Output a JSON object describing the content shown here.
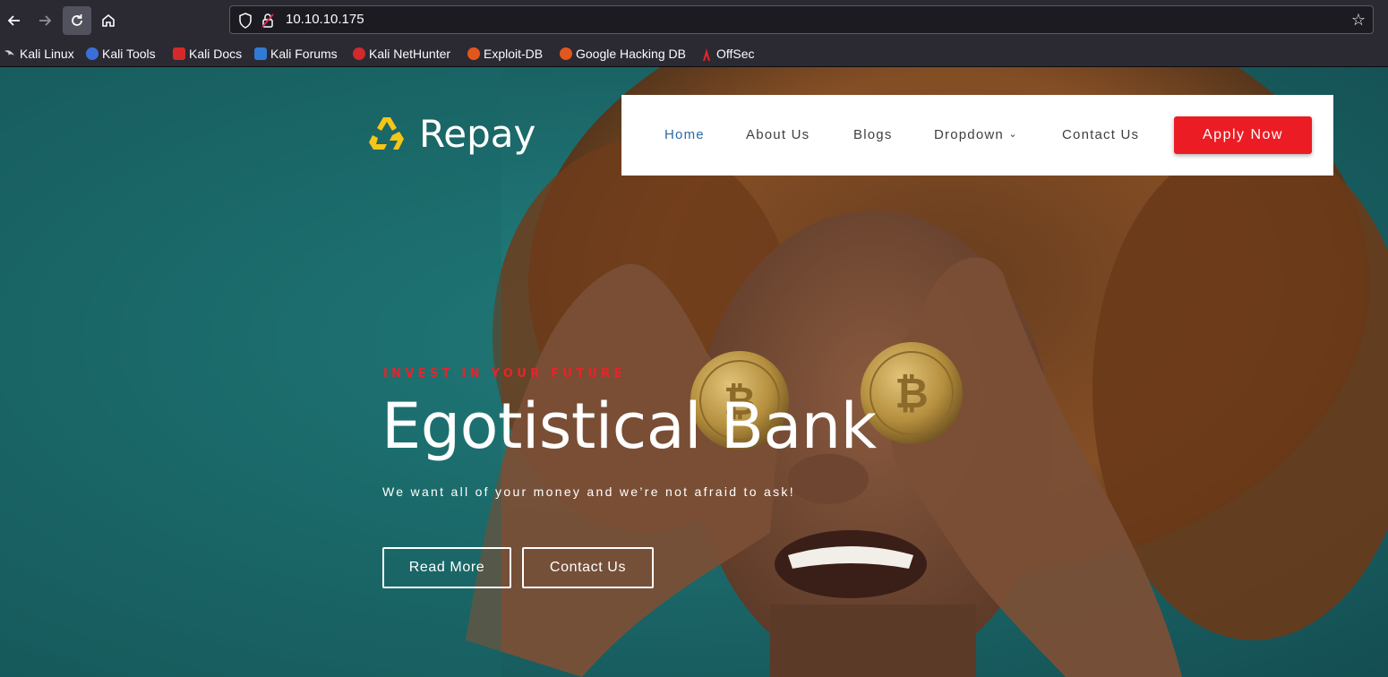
{
  "browser": {
    "url": "10.10.10.175",
    "bookmarks": [
      {
        "label": "Kali Linux",
        "icon": "kali-dragon-icon"
      },
      {
        "label": "Kali Tools",
        "icon": "kali-tools-icon"
      },
      {
        "label": "Kali Docs",
        "icon": "kali-docs-icon"
      },
      {
        "label": "Kali Forums",
        "icon": "kali-forums-icon"
      },
      {
        "label": "Kali NetHunter",
        "icon": "nethunter-icon"
      },
      {
        "label": "Exploit-DB",
        "icon": "exploit-db-icon"
      },
      {
        "label": "Google Hacking DB",
        "icon": "ghdb-icon"
      },
      {
        "label": "OffSec",
        "icon": "offsec-icon"
      }
    ]
  },
  "site": {
    "logo_text": "Repay",
    "nav": {
      "items": [
        "Home",
        "About Us",
        "Blogs",
        "Dropdown",
        "Contact Us"
      ],
      "dropdown_caret": "⌄",
      "apply_label": "Apply Now"
    },
    "hero": {
      "eyebrow": "INVEST IN YOUR FUTURE",
      "title": "Egotistical Bank",
      "tagline": "We want all of your money and we’re not afraid to ask!",
      "buttons": [
        "Read More",
        "Contact Us"
      ]
    }
  },
  "colors": {
    "accent_red": "#ec1c24",
    "nav_active": "#2b6aa3",
    "hero_teal": "#1e6f6f",
    "logo_yellow": "#f5c518"
  }
}
